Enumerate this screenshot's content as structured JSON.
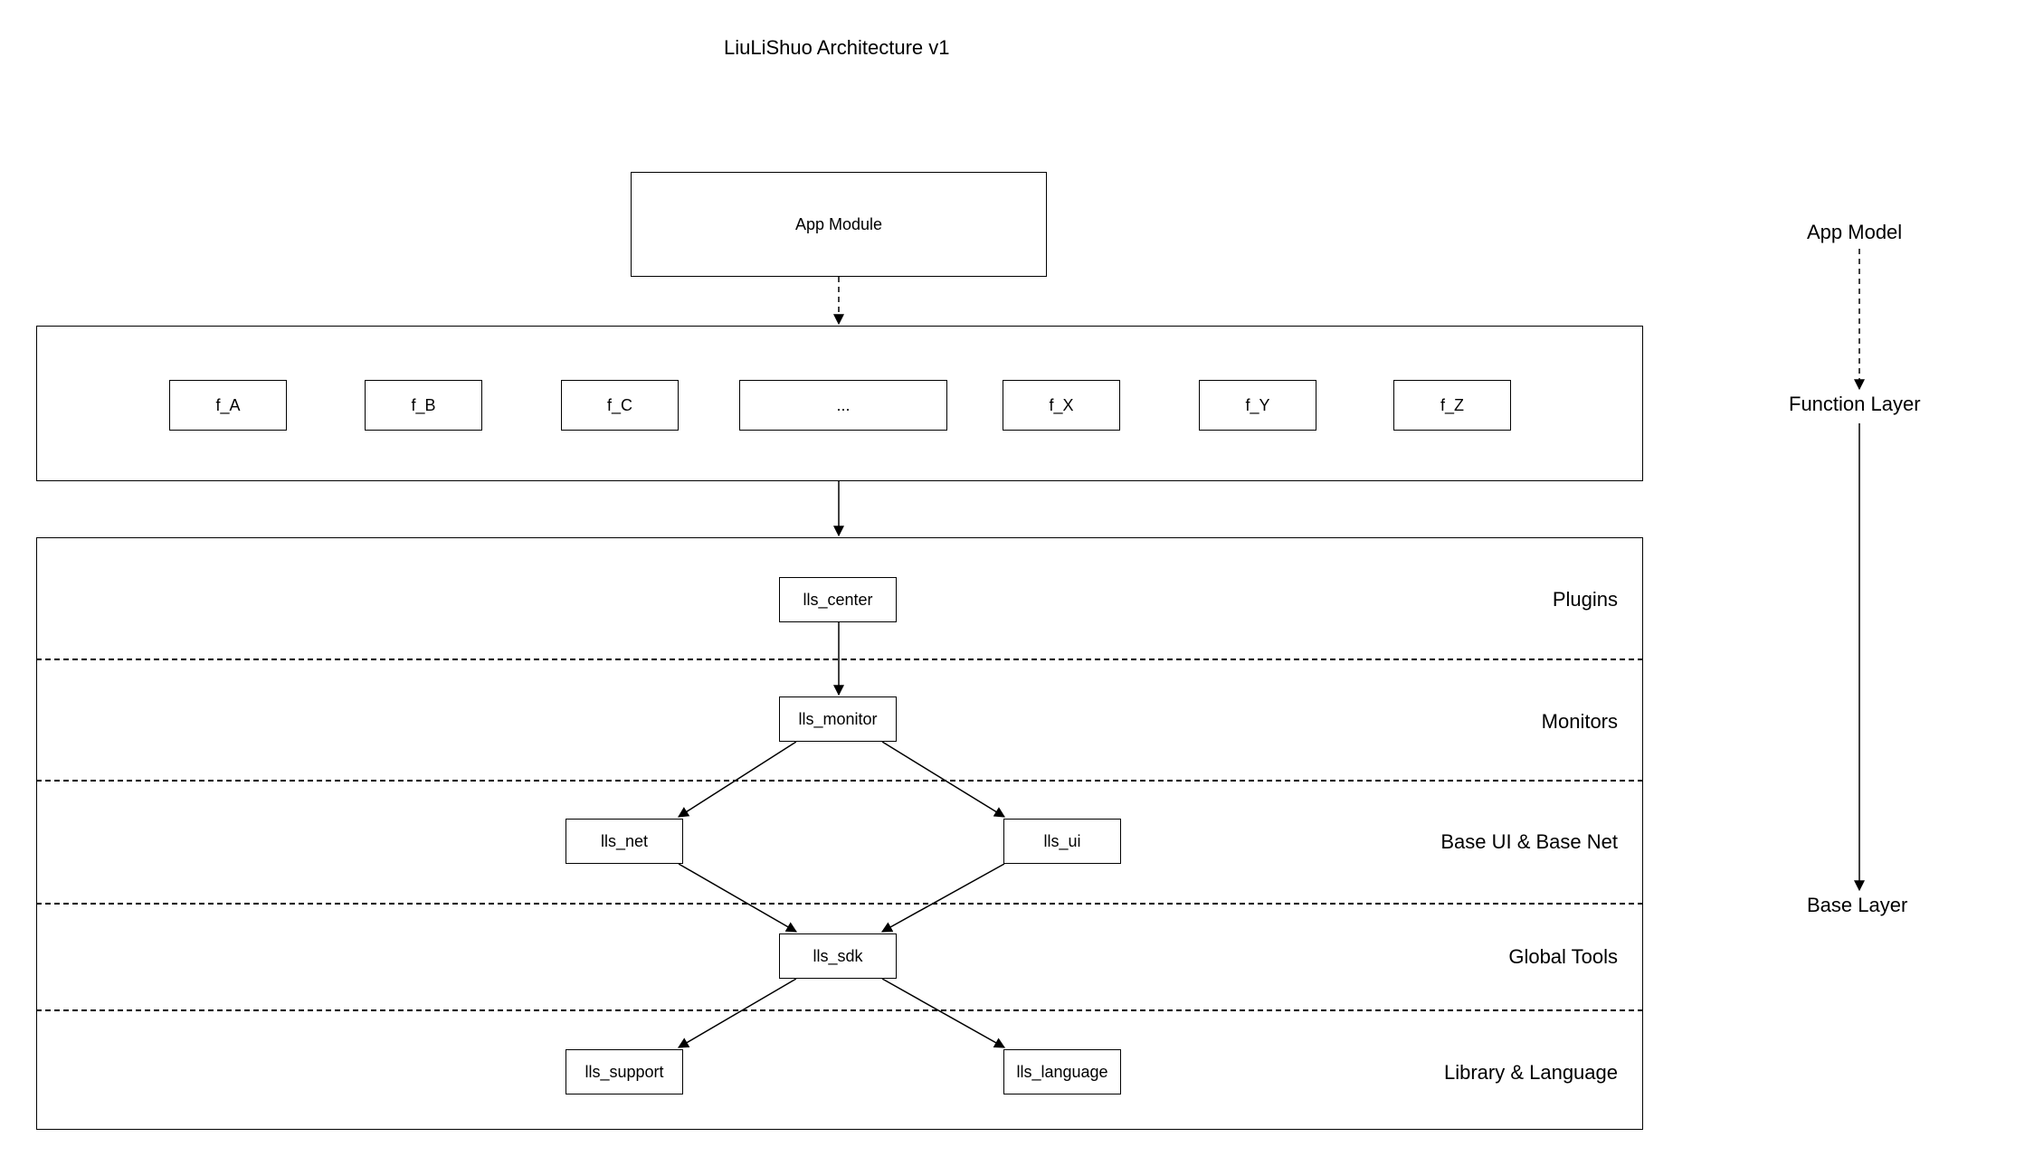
{
  "title": "LiuLiShuo Architecture v1",
  "app_module": {
    "label": "App Module"
  },
  "functions": {
    "items": [
      {
        "label": "f_A"
      },
      {
        "label": "f_B"
      },
      {
        "label": "f_C"
      },
      {
        "label": "..."
      },
      {
        "label": "f_X"
      },
      {
        "label": "f_Y"
      },
      {
        "label": "f_Z"
      }
    ]
  },
  "base_layer": {
    "rows": [
      {
        "label": "Plugins",
        "nodes": [
          {
            "label": "lls_center"
          }
        ]
      },
      {
        "label": "Monitors",
        "nodes": [
          {
            "label": "lls_monitor"
          }
        ]
      },
      {
        "label": "Base UI & Base Net",
        "nodes": [
          {
            "label": "lls_net"
          },
          {
            "label": "lls_ui"
          }
        ]
      },
      {
        "label": "Global Tools",
        "nodes": [
          {
            "label": "lls_sdk"
          }
        ]
      },
      {
        "label": "Library & Language",
        "nodes": [
          {
            "label": "lls_support"
          },
          {
            "label": "lls_language"
          }
        ]
      }
    ]
  },
  "side": {
    "app_model": "App Model",
    "function_layer": "Function Layer",
    "base_layer": "Base Layer"
  }
}
